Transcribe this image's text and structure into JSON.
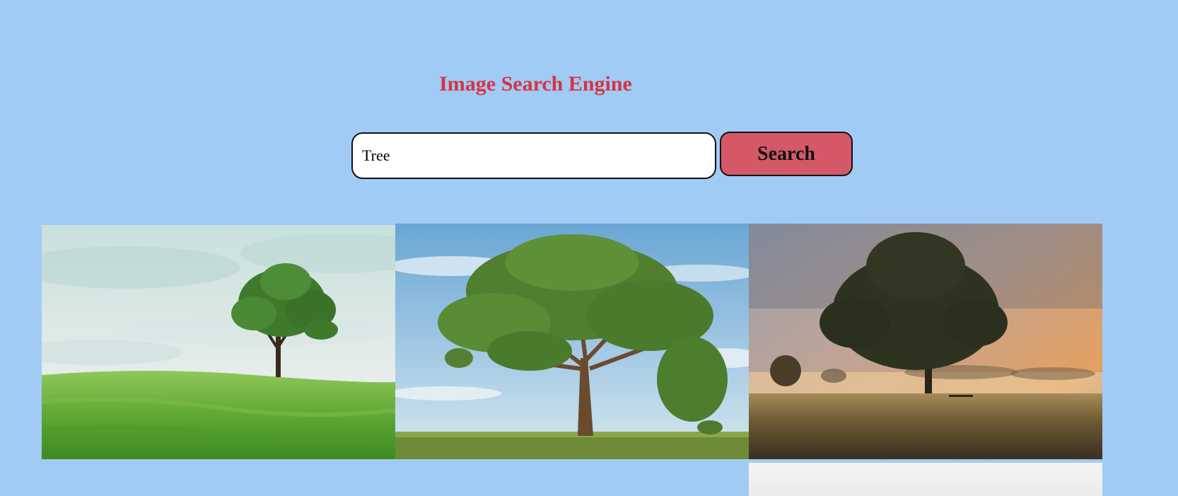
{
  "header": {
    "title": "Image Search Engine"
  },
  "search": {
    "value": "Tree",
    "button_label": "Search"
  },
  "results": [
    {
      "subject": "lone tree on green grassy hill under cloudy sky"
    },
    {
      "subject": "large spreading tree on meadow under blue sky"
    },
    {
      "subject": "tree silhouette in misty field at sunrise"
    },
    {
      "subject": "light grey image, partially visible"
    }
  ],
  "colors": {
    "background": "#a0cbf5",
    "title": "#d93340",
    "button": "#d45868",
    "input_bg": "#ffffff"
  }
}
